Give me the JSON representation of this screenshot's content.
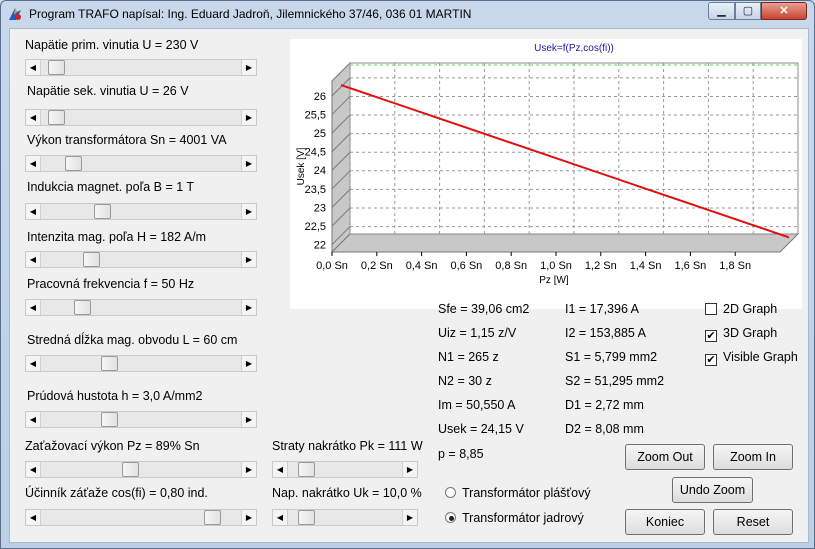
{
  "window": {
    "title": "Program TRAFO napísal: Ing. Eduard Jadroň, Jilemnického 37/46, 036 01 MARTIN"
  },
  "sliders": [
    {
      "label": "Napätie prim. vinutia U = 230 V",
      "level": 0.04
    },
    {
      "label": "Napätie sek.  vinutia U = 26 V",
      "level": 0.04
    },
    {
      "label": "Výkon transformátora Sn = 4001 VA",
      "level": 0.13
    },
    {
      "label": "Indukcia magnet. poľa B = 1 T",
      "level": 0.29
    },
    {
      "label": "Intenzita mag. poľa  H = 182 A/m",
      "level": 0.23
    },
    {
      "label": "Pracovná frekvencia  f = 50 Hz",
      "level": 0.18
    },
    {
      "label": "Stredná dĺžka mag. obvodu L = 60 cm",
      "level": 0.33
    },
    {
      "label": "Prúdová hustota h = 3,0 A/mm2",
      "level": 0.33
    },
    {
      "label": "Zaťažovací výkon Pz = 89% Sn",
      "level": 0.44
    },
    {
      "label": "Účinník záťaže cos(fi) = 0,80 ind.",
      "level": 0.89
    },
    {
      "label": "Straty nakrátko Pk = 111 W",
      "level": 0.1
    },
    {
      "label": "Nap. nakrátko Uk = 10,0 %",
      "level": 0.1
    }
  ],
  "results_left": [
    "Sfe = 39,06 cm2",
    "Uiz = 1,15 z/V",
    "N1 = 265 z",
    "N2 =  30 z",
    "Im = 50,550 A",
    "Usek = 24,15 V",
    "p = 8,85"
  ],
  "results_right": [
    "I1 = 17,396 A",
    "I2 = 153,885 A",
    "S1 = 5,799 mm2",
    "S2 = 51,295 mm2",
    "D1 = 2,72 mm",
    "D2 = 8,08 mm"
  ],
  "checkboxes": [
    {
      "label": "2D Graph",
      "checked": false
    },
    {
      "label": "3D Graph",
      "checked": true
    },
    {
      "label": "Visible Graph",
      "checked": true
    }
  ],
  "radios": [
    {
      "label": "Transformátor plášťový",
      "selected": false
    },
    {
      "label": "Transformátor jadrový",
      "selected": true
    }
  ],
  "buttons": {
    "zoom_out": "Zoom Out",
    "zoom_in": "Zoom In",
    "undo_zoom": "Undo Zoom",
    "koniec": "Koniec",
    "reset": "Reset"
  },
  "colors": {
    "line": "#e01010",
    "grid_top": "#66cc66",
    "floor": "#c0c0c0"
  },
  "chart_data": {
    "type": "line",
    "title": "Usek=f(Pz,cos(fi))",
    "xlabel": "Pz [W]",
    "ylabel": "Usek [V]",
    "x_ticks": [
      "0,0 Sn",
      "0,2 Sn",
      "0,4 Sn",
      "0,6 Sn",
      "0,8 Sn",
      "1,0 Sn",
      "1,2 Sn",
      "1,4 Sn",
      "1,6 Sn",
      "1,8 Sn"
    ],
    "y_ticks": [
      "22",
      "22,5",
      "23",
      "23,5",
      "24",
      "24,5",
      "25",
      "25,5",
      "26"
    ],
    "xlim": [
      0,
      2.0
    ],
    "ylim": [
      21.8,
      26.4
    ],
    "grid": true,
    "series": [
      {
        "x": [
          0,
          2.0
        ],
        "values": [
          26.05,
          21.95
        ]
      }
    ]
  }
}
